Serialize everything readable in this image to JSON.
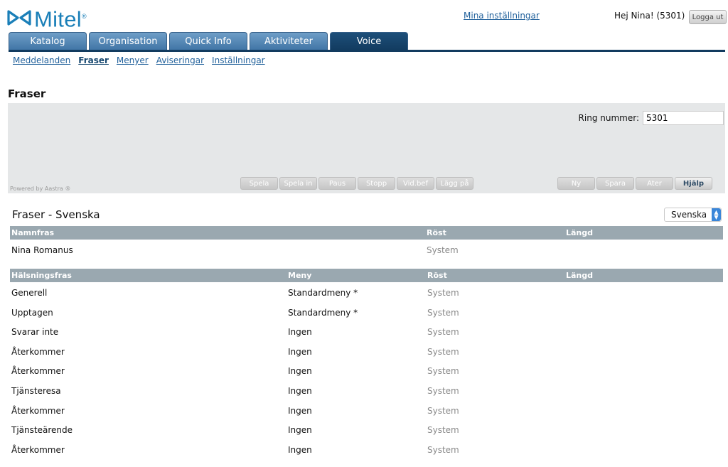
{
  "header": {
    "logo_text": "Mitel",
    "settings_link": "Mina inställningar",
    "greeting": "Hej Nina! (5301)",
    "logout_label": "Logga ut"
  },
  "tabs": [
    {
      "label": "Katalog",
      "active": false
    },
    {
      "label": "Organisation",
      "active": false
    },
    {
      "label": "Quick Info",
      "active": false
    },
    {
      "label": "Aktiviteter",
      "active": false
    },
    {
      "label": "Voice",
      "active": true
    }
  ],
  "subnav": [
    {
      "label": "Meddelanden",
      "active": false
    },
    {
      "label": "Fraser",
      "active": true
    },
    {
      "label": "Menyer",
      "active": false
    },
    {
      "label": "Aviseringar",
      "active": false
    },
    {
      "label": "Inställningar",
      "active": false
    }
  ],
  "page_title": "Fraser",
  "player": {
    "ring_label": "Ring nummer:",
    "ring_value": "5301",
    "powered_by": "Powered by Aastra ®",
    "playback_buttons": [
      "Spela",
      "Spela in",
      "Paus",
      "Stopp",
      "Vid.bef",
      "Lägg på"
    ],
    "action_buttons": [
      "Ny",
      "Spara",
      "Ater",
      "Hjälp"
    ]
  },
  "section": {
    "title": "Fraser - Svenska",
    "language_selected": "Svenska"
  },
  "name_table": {
    "headers": [
      "Namnfras",
      "Röst",
      "Längd"
    ],
    "rows": [
      {
        "name": "Nina Romanus",
        "voice": "System",
        "length": ""
      }
    ]
  },
  "greeting_table": {
    "headers": [
      "Hälsningsfras",
      "Meny",
      "Röst",
      "Längd"
    ],
    "rows": [
      {
        "name": "Generell",
        "menu": "Standardmeny *",
        "voice": "System"
      },
      {
        "name": "Upptagen",
        "menu": "Standardmeny *",
        "voice": "System"
      },
      {
        "name": "Svarar inte",
        "menu": "Ingen",
        "voice": "System"
      },
      {
        "name": "Återkommer",
        "menu": "Ingen",
        "voice": "System"
      },
      {
        "name": "Återkommer",
        "menu": "Ingen",
        "voice": "System"
      },
      {
        "name": "Tjänsteresa",
        "menu": "Ingen",
        "voice": "System"
      },
      {
        "name": "Återkommer",
        "menu": "Ingen",
        "voice": "System"
      },
      {
        "name": "Tjänsteärende",
        "menu": "Ingen",
        "voice": "System"
      },
      {
        "name": "Återkommer",
        "menu": "Ingen",
        "voice": "System"
      }
    ]
  },
  "colors": {
    "tab_active": "#123b5f",
    "tab_inactive": "#4f83b3",
    "link": "#1f5f9a",
    "table_header": "#9aa8b0",
    "panel_bg": "#e5e7e8",
    "logo": "#1a7fb8"
  }
}
